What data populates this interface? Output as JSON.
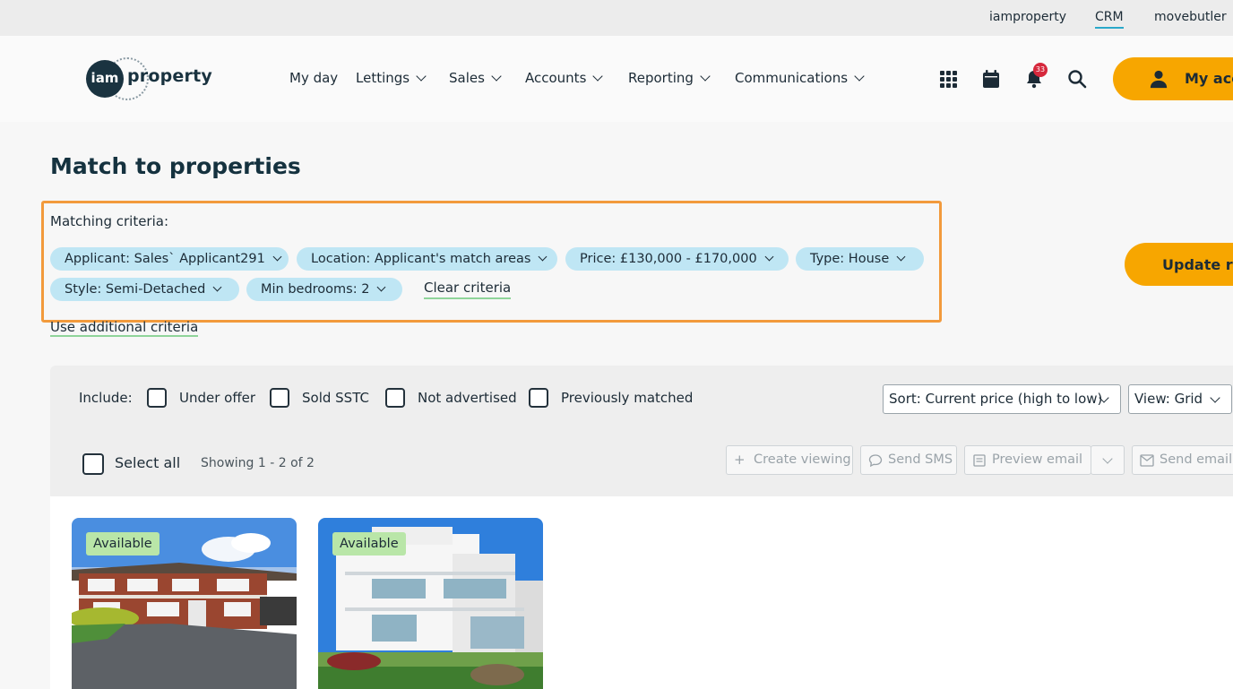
{
  "topbar": {
    "links": [
      "iamproperty",
      "CRM",
      "movebutler"
    ]
  },
  "brand": {
    "logo_mark": "iam",
    "logo_word": "property"
  },
  "nav": {
    "items": [
      "My day",
      "Lettings",
      "Sales",
      "Accounts",
      "Reporting",
      "Communications"
    ],
    "icons": [
      "apps-grid-icon",
      "calendar-icon",
      "bell-icon",
      "search-icon"
    ],
    "notification_count": "33",
    "account_label": "My acco"
  },
  "page": {
    "title": "Match to properties"
  },
  "criteria": {
    "label": "Matching criteria:",
    "chips": [
      "Applicant: Sales` Applicant291",
      "Location: Applicant's match areas",
      "Price: £130,000 - £170,000",
      "Type: House",
      "Style: Semi-Detached",
      "Min bedrooms: 2"
    ],
    "clear_label": "Clear criteria",
    "additional_label": "Use additional criteria",
    "update_label": "Update re"
  },
  "filters": {
    "include_label": "Include:",
    "checkboxes": [
      "Under offer",
      "Sold SSTC",
      "Not advertised",
      "Previously matched"
    ],
    "sort_value": "Sort: Current price (high to low)",
    "view_value": "View: Grid"
  },
  "results": {
    "select_all_label": "Select all",
    "showing_text": "Showing 1 - 2 of 2",
    "actions": [
      "Create viewing",
      "Send SMS",
      "Preview email",
      "Send email"
    ],
    "cards": [
      {
        "status": "Available"
      },
      {
        "status": "Available"
      }
    ]
  },
  "colors": {
    "accent": "#f7a600",
    "chip": "#bfe6f4",
    "highlight": "#f29a3c",
    "status": "#b9e6a8"
  }
}
